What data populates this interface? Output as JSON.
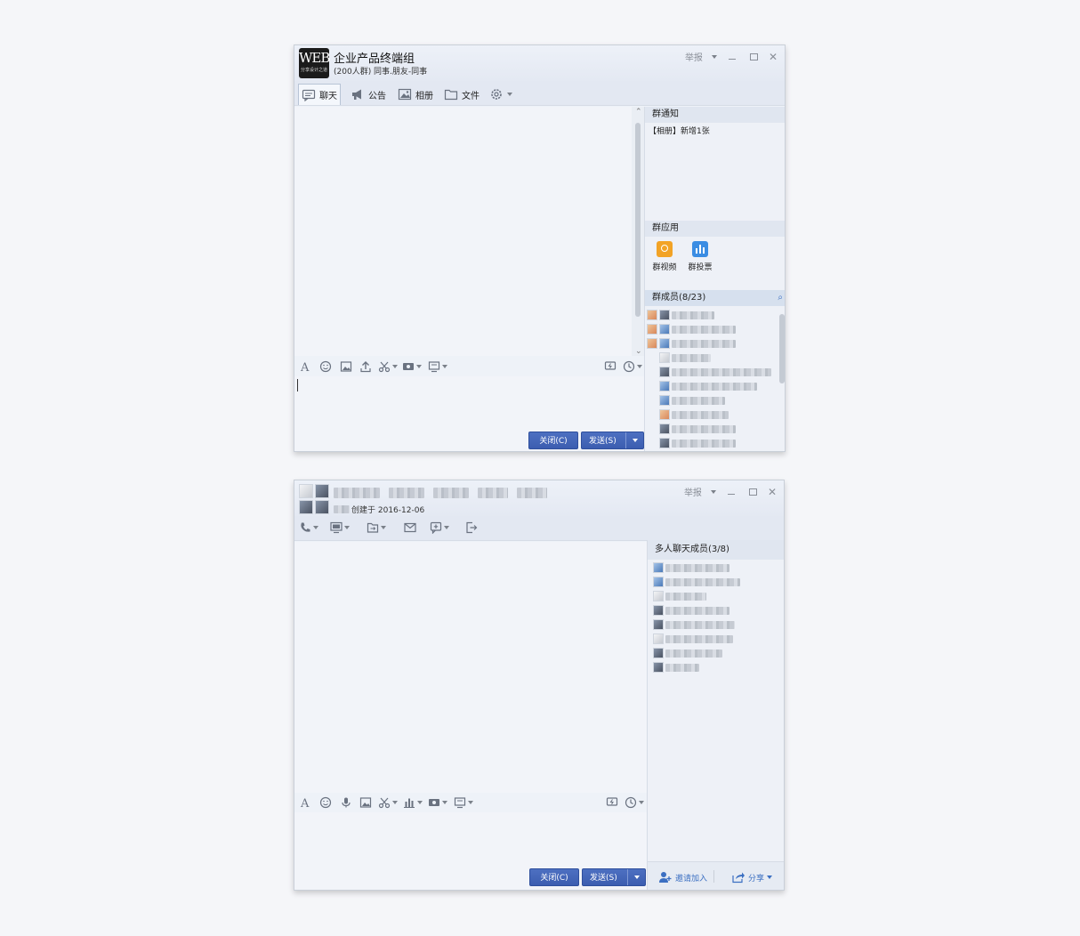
{
  "window1": {
    "group_logo": {
      "main": "WEB",
      "small": "分享设计之道"
    },
    "title": "企业产品终端组",
    "subtitle": "(200人群) 同事.朋友-同事",
    "report_label": "举报",
    "tabs": [
      {
        "label": "聊天",
        "icon": "chat-bubble-icon"
      },
      {
        "label": "公告",
        "icon": "megaphone-icon"
      },
      {
        "label": "相册",
        "icon": "photo-album-icon"
      },
      {
        "label": "文件",
        "icon": "folder-icon"
      }
    ],
    "notice_header": "群通知",
    "notice_text": "【相册】新增1张",
    "apps_header": "群应用",
    "apps": [
      {
        "label": "群视频",
        "color": "#f2a326",
        "icon": "group-video-icon"
      },
      {
        "label": "群投票",
        "color": "#3b8de3",
        "icon": "group-vote-icon"
      }
    ],
    "members_header": "群成员(8/23)",
    "close_button": "关闭(C)",
    "send_button": "发送(S)"
  },
  "window2": {
    "created_text": "创建于 2016-12-06",
    "report_label": "举报",
    "members_header": "多人聊天成员(3/8)",
    "close_button": "关闭(C)",
    "send_button": "发送(S)",
    "invite_label": "邀请加入",
    "share_label": "分享"
  }
}
